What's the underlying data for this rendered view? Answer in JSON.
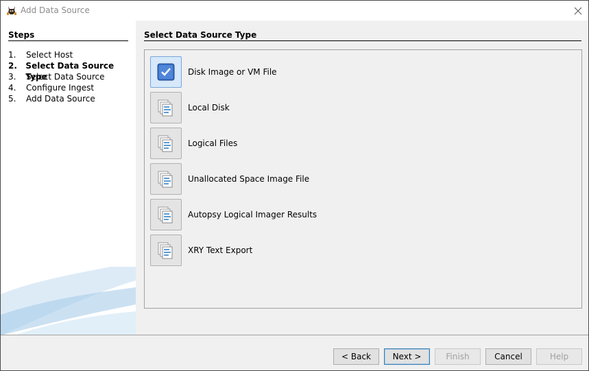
{
  "window": {
    "title": "Add Data Source"
  },
  "steps": {
    "heading": "Steps",
    "items": [
      {
        "num": "1.",
        "label": "Select Host",
        "current": false
      },
      {
        "num": "2.",
        "label": "Select Data Source Type",
        "current": true
      },
      {
        "num": "3.",
        "label": "Select Data Source",
        "current": false
      },
      {
        "num": "4.",
        "label": "Configure Ingest",
        "current": false
      },
      {
        "num": "5.",
        "label": "Add Data Source",
        "current": false
      }
    ]
  },
  "main": {
    "heading": "Select Data Source Type",
    "types": [
      {
        "label": "Disk Image or VM File",
        "icon": "disk-image-icon",
        "selected": true
      },
      {
        "label": "Local Disk",
        "icon": "local-disk-icon",
        "selected": false
      },
      {
        "label": "Logical Files",
        "icon": "logical-files-icon",
        "selected": false
      },
      {
        "label": "Unallocated Space Image File",
        "icon": "unallocated-space-icon",
        "selected": false
      },
      {
        "label": "Autopsy Logical Imager Results",
        "icon": "logical-imager-icon",
        "selected": false
      },
      {
        "label": "XRY Text Export",
        "icon": "xry-export-icon",
        "selected": false
      }
    ]
  },
  "buttons": {
    "back": "< Back",
    "next": "Next >",
    "finish": "Finish",
    "cancel": "Cancel",
    "help": "Help"
  },
  "colors": {
    "selected_bg": "#d6e8fa",
    "accent_blue": "#3c6fc4"
  }
}
